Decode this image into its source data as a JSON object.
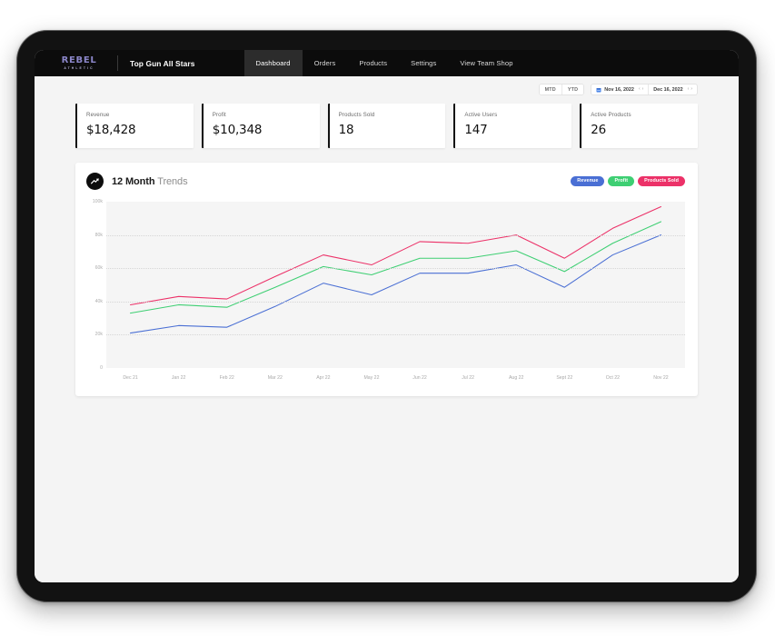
{
  "brand": {
    "logo_main": "REBEL",
    "logo_sub": "ATHLETIC",
    "logo_color": "#8b86c9",
    "team_name": "Top Gun All Stars"
  },
  "nav": {
    "items": [
      {
        "label": "Dashboard",
        "active": true
      },
      {
        "label": "Orders",
        "active": false
      },
      {
        "label": "Products",
        "active": false
      },
      {
        "label": "Settings",
        "active": false
      },
      {
        "label": "View Team Shop",
        "active": false
      }
    ]
  },
  "date_controls": {
    "segments": [
      {
        "label": "MTD"
      },
      {
        "label": "YTD"
      }
    ],
    "start_date": "Nov 16, 2022",
    "end_date": "Dec 16, 2022",
    "prev_arrow": "‹",
    "next_arrow": "›"
  },
  "kpis": [
    {
      "label": "Revenue",
      "value": "$18,428"
    },
    {
      "label": "Profit",
      "value": "$10,348"
    },
    {
      "label": "Products Sold",
      "value": "18"
    },
    {
      "label": "Active Users",
      "value": "147"
    },
    {
      "label": "Active Products",
      "value": "26"
    }
  ],
  "chart_card": {
    "title_bold": "12 Month",
    "title_light": "Trends",
    "icon": "trending-up-icon",
    "legend": [
      {
        "label": "Revenue",
        "color": "#4a6fd4"
      },
      {
        "label": "Profit",
        "color": "#3ecf73"
      },
      {
        "label": "Products Sold",
        "color": "#ec3168"
      }
    ]
  },
  "chart_data": {
    "type": "line",
    "title": "12 Month Trends",
    "xlabel": "",
    "ylabel": "",
    "ylim": [
      0,
      100000
    ],
    "grid": true,
    "legend_position": "top-right",
    "ytick_labels": [
      "0",
      "20k",
      "40k",
      "60k",
      "80k",
      "100k"
    ],
    "ytick_values": [
      0,
      20000,
      40000,
      60000,
      80000,
      100000
    ],
    "categories": [
      "Dec 21",
      "Jan 22",
      "Feb 22",
      "Mar 22",
      "Apr 22",
      "May 22",
      "Jun 22",
      "Jul 22",
      "Aug 22",
      "Sept 22",
      "Oct 22",
      "Nov 22"
    ],
    "series": [
      {
        "name": "Products Sold",
        "color": "#ec3168",
        "values": [
          38000,
          43000,
          41500,
          55000,
          68000,
          62000,
          76000,
          75000,
          80000,
          66000,
          84000,
          97000
        ]
      },
      {
        "name": "Profit",
        "color": "#3ecf73",
        "values": [
          33000,
          38000,
          36500,
          48500,
          61000,
          56000,
          66000,
          66000,
          70500,
          58000,
          75000,
          88000
        ]
      },
      {
        "name": "Revenue",
        "color": "#4a6fd4",
        "values": [
          21000,
          25500,
          24500,
          37000,
          51000,
          44000,
          57000,
          57000,
          62000,
          48500,
          68000,
          80000
        ]
      }
    ]
  }
}
